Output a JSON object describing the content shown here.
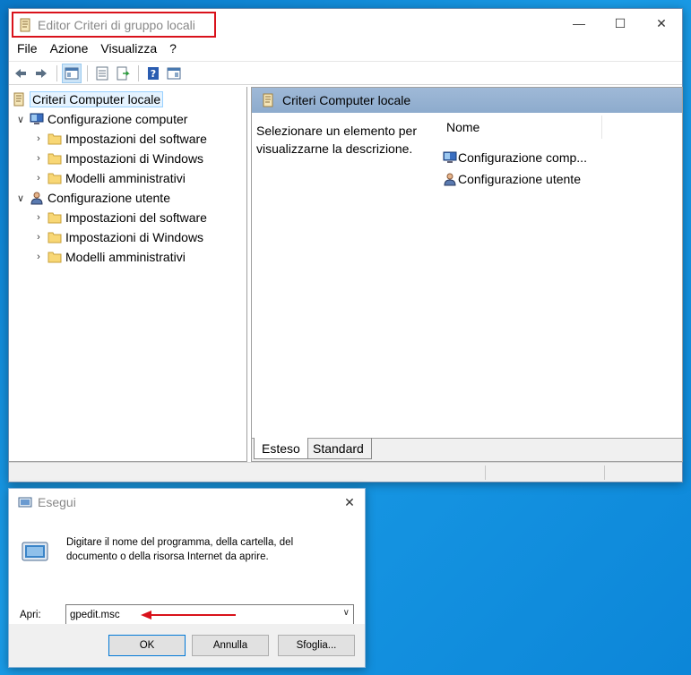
{
  "gpedit": {
    "title": "Editor Criteri di gruppo locali",
    "menu": [
      "File",
      "Azione",
      "Visualizza",
      "?"
    ],
    "caption": {
      "minimize": "—",
      "maximize": "☐",
      "close": "✕"
    },
    "toolbar_icons": [
      "back-arrow-icon",
      "forward-arrow-icon",
      "show-hide-tree-icon",
      "properties-icon",
      "export-list-icon",
      "help-icon",
      "extended-view-icon"
    ],
    "tree": {
      "root": "Criteri Computer locale",
      "computer": {
        "label": "Configurazione computer",
        "children": [
          "Impostazioni del software",
          "Impostazioni di Windows",
          "Modelli amministrativi"
        ]
      },
      "user": {
        "label": "Configurazione utente",
        "children": [
          "Impostazioni del software",
          "Impostazioni di Windows",
          "Modelli amministrativi"
        ]
      }
    },
    "right": {
      "header": "Criteri Computer locale",
      "description": "Selezionare un elemento per visualizzarne la descrizione.",
      "column_name": "Nome",
      "items": [
        "Configurazione comp...",
        "Configurazione utente"
      ],
      "tabs": [
        "Esteso",
        "Standard"
      ]
    }
  },
  "run": {
    "title": "Esegui",
    "close": "✕",
    "description": "Digitare il nome del programma, della cartella, del documento o della risorsa Internet da aprire.",
    "open_label": "Apri:",
    "open_value": "gpedit.msc",
    "buttons": {
      "ok": "OK",
      "cancel": "Annulla",
      "browse": "Sfoglia..."
    }
  },
  "colors": {
    "highlight_box": "#d9121b",
    "desktop": "#0a78c8",
    "pane_header": "#9fb9d7"
  }
}
